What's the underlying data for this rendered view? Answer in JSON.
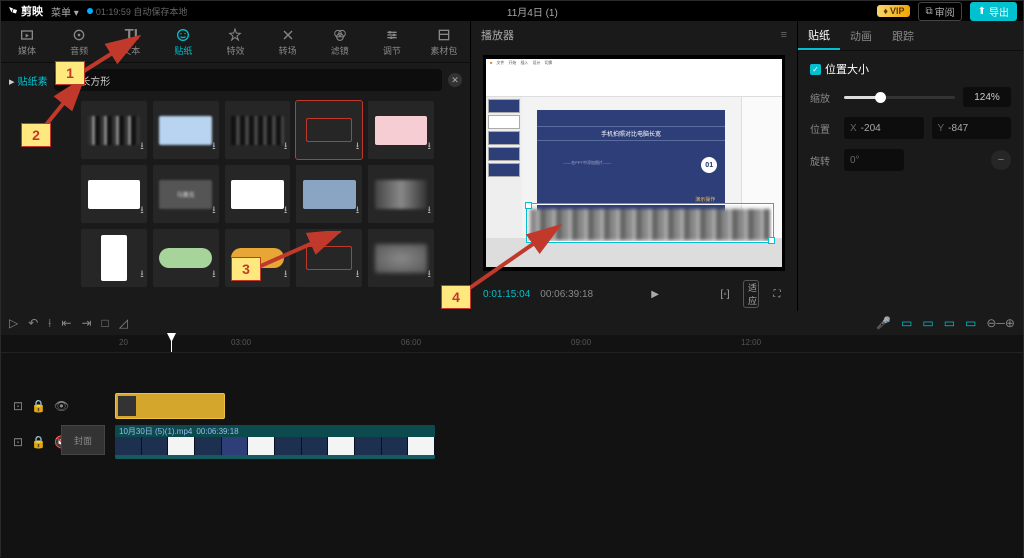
{
  "topbar": {
    "app_name": "剪映",
    "menu": "菜单",
    "autosave": "01:19:59 自动保存本地",
    "project_name": "11月4日 (1)",
    "vip": "VIP",
    "shortcut": "审阅",
    "export": "导出"
  },
  "media_nav": [
    "媒体",
    "音频",
    "文本",
    "贴纸",
    "特效",
    "转场",
    "滤镜",
    "调节",
    "素材包"
  ],
  "media_nav_active_index": 3,
  "sidebar_tag": "贴纸素",
  "search": {
    "placeholder": "",
    "value": "长方形"
  },
  "player": {
    "title": "播放器",
    "current_time": "0:01:15:04",
    "total_time": "00:06:39:18",
    "ratio_btn": "适应",
    "slide_title": "手机拍照对比电脑长宽",
    "slide_watermark": "演示操作",
    "slide_number": "01"
  },
  "props": {
    "tabs": [
      "贴纸",
      "动画",
      "跟踪"
    ],
    "active_tab_index": 0,
    "section_title": "位置大小",
    "scale_label": "缩放",
    "scale_value": "124%",
    "pos_label": "位置",
    "pos_x": "-204",
    "pos_y": "-847",
    "rotate_label": "旋转",
    "rotate_value": "0°"
  },
  "timeline": {
    "ruler_marks": [
      "20",
      "03:00",
      "06:00",
      "09:00",
      "12:00"
    ],
    "video_clip_name": "10月30日 (5)(1).mp4",
    "video_clip_dur": "00:06:39:18",
    "cover_label": "封面"
  },
  "callouts": {
    "c1": "1",
    "c2": "2",
    "c3": "3",
    "c4": "4"
  }
}
